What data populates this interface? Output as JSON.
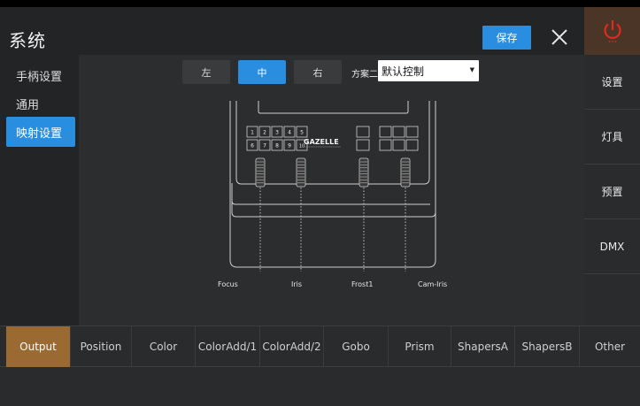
{
  "app": {
    "title": "系统"
  },
  "header": {
    "save_label": "保存"
  },
  "sidebar": {
    "items": [
      {
        "label": "手柄设置"
      },
      {
        "label": "通用"
      },
      {
        "label": "映射设置"
      }
    ]
  },
  "toolbar": {
    "segments": [
      {
        "label": "左"
      },
      {
        "label": "中"
      },
      {
        "label": "右"
      }
    ],
    "scheme_label": "方案二",
    "scheme_value": "默认控制"
  },
  "device": {
    "brand": "GAZELLE",
    "keypad": [
      "1",
      "2",
      "3",
      "4",
      "5",
      "6",
      "7",
      "8",
      "9",
      "10"
    ],
    "fader_labels": [
      "Focus",
      "Iris",
      "Frost1",
      "Cam-Iris"
    ]
  },
  "rail": {
    "items": [
      {
        "label": "设置"
      },
      {
        "label": "灯具"
      },
      {
        "label": "预置"
      },
      {
        "label": "DMX"
      },
      {
        "label": ""
      }
    ]
  },
  "tabs": [
    {
      "label": "Output"
    },
    {
      "label": "Position"
    },
    {
      "label": "Color"
    },
    {
      "label": "ColorAdd/1"
    },
    {
      "label": "ColorAdd/2"
    },
    {
      "label": "Gobo"
    },
    {
      "label": "Prism"
    },
    {
      "label": "ShapersA"
    },
    {
      "label": "ShapersB"
    },
    {
      "label": "Other"
    }
  ],
  "colors": {
    "accent": "#2a8ee0",
    "active_tab": "#9a6a32",
    "power_bg": "#4a3527",
    "power_icon": "#e0291f"
  },
  "icons": {
    "close": "close-icon",
    "power": "power-icon"
  }
}
